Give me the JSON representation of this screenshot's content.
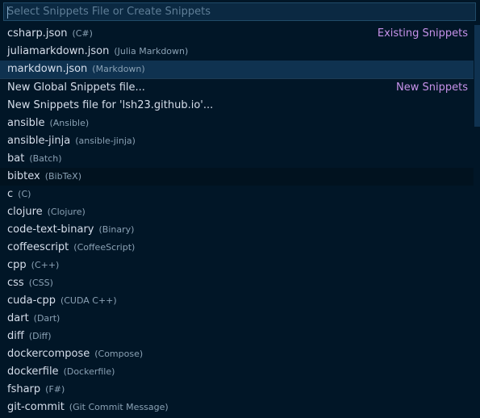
{
  "input": {
    "placeholder": "Select Snippets File or Create Snippets"
  },
  "groups": {
    "existing": "Existing Snippets",
    "new": "New Snippets"
  },
  "existing_items": [
    {
      "label": "csharp.json",
      "desc": "(C#)"
    },
    {
      "label": "juliamarkdown.json",
      "desc": "(Julia Markdown)"
    },
    {
      "label": "markdown.json",
      "desc": "(Markdown)"
    }
  ],
  "new_items": [
    {
      "label": "New Global Snippets file...",
      "desc": ""
    },
    {
      "label": "New Snippets file for 'lsh23.github.io'...",
      "desc": ""
    },
    {
      "label": "ansible",
      "desc": "(Ansible)"
    },
    {
      "label": "ansible-jinja",
      "desc": "(ansible-jinja)"
    },
    {
      "label": "bat",
      "desc": "(Batch)"
    },
    {
      "label": "bibtex",
      "desc": "(BibTeX)"
    },
    {
      "label": "c",
      "desc": "(C)"
    },
    {
      "label": "clojure",
      "desc": "(Clojure)"
    },
    {
      "label": "code-text-binary",
      "desc": "(Binary)"
    },
    {
      "label": "coffeescript",
      "desc": "(CoffeeScript)"
    },
    {
      "label": "cpp",
      "desc": "(C++)"
    },
    {
      "label": "css",
      "desc": "(CSS)"
    },
    {
      "label": "cuda-cpp",
      "desc": "(CUDA C++)"
    },
    {
      "label": "dart",
      "desc": "(Dart)"
    },
    {
      "label": "diff",
      "desc": "(Diff)"
    },
    {
      "label": "dockercompose",
      "desc": "(Compose)"
    },
    {
      "label": "dockerfile",
      "desc": "(Dockerfile)"
    },
    {
      "label": "fsharp",
      "desc": "(F#)"
    },
    {
      "label": "git-commit",
      "desc": "(Git Commit Message)"
    }
  ],
  "colors": {
    "background": "#011627",
    "focus_background": "#0f3250",
    "group_label": "#c792ea",
    "text": "#d6deeb",
    "description": "#8aa1b4"
  }
}
